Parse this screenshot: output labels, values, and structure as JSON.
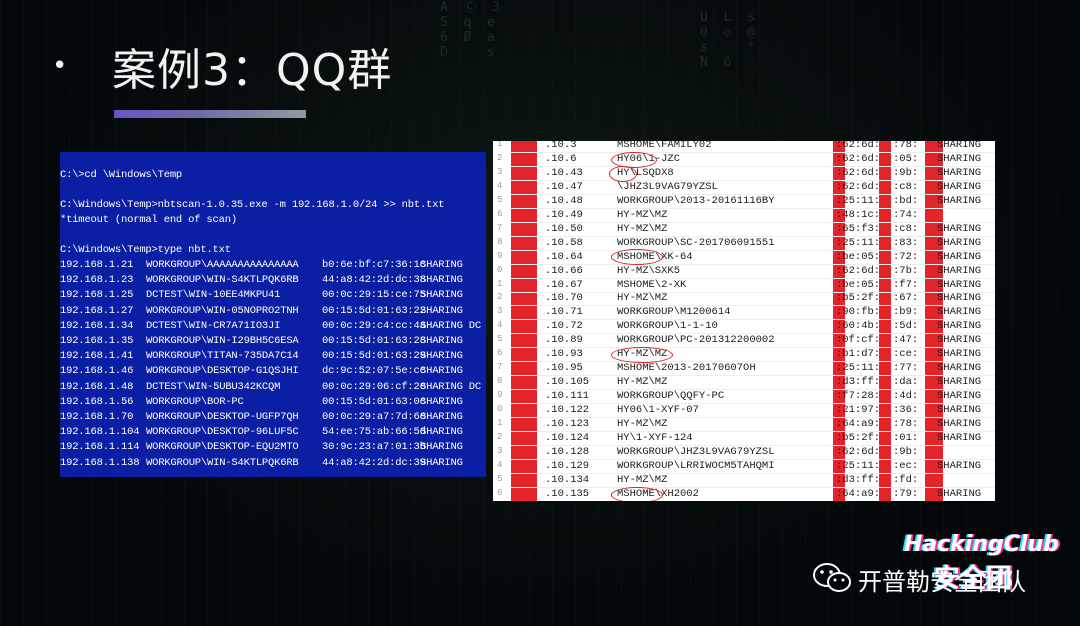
{
  "slide": {
    "bullet": "•",
    "title": "案例3：QQ群"
  },
  "terminal": {
    "lines": [
      "C:\\>cd \\Windows\\Temp",
      "C:\\Windows\\Temp>nbtscan-1.0.35.exe -m 192.168.1.0/24 >> nbt.txt",
      "*timeout (normal end of scan)",
      "C:\\Windows\\Temp>type nbt.txt"
    ],
    "rows": [
      {
        "ip": "192.168.1.21",
        "name": "WORKGROUP\\AAAAAAAAAAAAAAA",
        "mac": "b0:6e:bf:c7:36:1c",
        "status": "SHARING"
      },
      {
        "ip": "192.168.1.23",
        "name": "WORKGROUP\\WIN-S4KTLPQK6RB",
        "mac": "44:a8:42:2d:dc:38",
        "status": "SHARING"
      },
      {
        "ip": "192.168.1.25",
        "name": "DCTEST\\WIN-10EE4MKPU41",
        "mac": "00:0c:29:15:ce:75",
        "status": "SHARING"
      },
      {
        "ip": "192.168.1.27",
        "name": "WORKGROUP\\WIN-05NOPRO2TNH",
        "mac": "00:15:5d:01:63:22",
        "status": "SHARING"
      },
      {
        "ip": "192.168.1.34",
        "name": "DCTEST\\WIN-CR7A71IO3JI",
        "mac": "00:0c:29:c4:cc:4a",
        "status": "SHARING DC"
      },
      {
        "ip": "192.168.1.35",
        "name": "WORKGROUP\\WIN-I29BH5C6ESA",
        "mac": "00:15:5d:01:63:28",
        "status": "SHARING"
      },
      {
        "ip": "192.168.1.41",
        "name": "WORKGROUP\\TITAN-735DA7C14",
        "mac": "00:15:5d:01:63:29",
        "status": "SHARING"
      },
      {
        "ip": "192.168.1.46",
        "name": "WORKGROUP\\DESKTOP-G1QSJHI",
        "mac": "dc:9c:52:07:5e:cc",
        "status": "SHARING"
      },
      {
        "ip": "192.168.1.48",
        "name": "DCTEST\\WIN-5UBU342KCQM",
        "mac": "00:0c:29:06:cf:2e",
        "status": "SHARING DC"
      },
      {
        "ip": "192.168.1.56",
        "name": "WORKGROUP\\BOR-PC",
        "mac": "00:15:5d:01:63:0c",
        "status": "SHARING"
      },
      {
        "ip": "192.168.1.70",
        "name": "WORKGROUP\\DESKTOP-UGFP7QH",
        "mac": "00:0c:29:a7:7d:6e",
        "status": "SHARING"
      },
      {
        "ip": "192.168.1.104",
        "name": "WORKGROUP\\DESKTOP-96LUF5C",
        "mac": "54:ee:75:ab:66:5d",
        "status": "SHARING"
      },
      {
        "ip": "192.168.1.114",
        "name": "WORKGROUP\\DESKTOP-EQU2MTO",
        "mac": "30:9c:23:a7:01:3b",
        "status": "SHARING"
      },
      {
        "ip": "192.168.1.138",
        "name": "WORKGROUP\\WIN-S4KTLPQK6RB",
        "mac": "44:a8:42:2d:dc:39",
        "status": "SHARING"
      }
    ]
  },
  "sheet": {
    "rows": [
      {
        "n": "1",
        "ip": ".10.3",
        "name": "MSHOME\\FAMILY02",
        "mac": ":62:6d:",
        "m2": ":78:",
        "status": "SHARING"
      },
      {
        "n": "2",
        "ip": ".10.6",
        "name": "HY06\\1-JZC",
        "mac": ":62:6d:",
        "m2": ":05:",
        "status": "SHARING"
      },
      {
        "n": "3",
        "ip": ".10.43",
        "name": "HY\\LSQDX8",
        "mac": ":62:6d:",
        "m2": ":9b:",
        "status": "SHARING"
      },
      {
        "n": "4",
        "ip": ".10.47",
        "name": "\\JHZ3L9VAG79YZSL",
        "mac": ":62:6d:",
        "m2": ":c8:",
        "status": "SHARING"
      },
      {
        "n": "5",
        "ip": ".10.48",
        "name": "WORKGROUP\\2013-20161116BY",
        "mac": ":25:11:",
        "m2": ":bd:",
        "status": "SHARING"
      },
      {
        "n": "6",
        "ip": ".10.49",
        "name": "HY-MZ\\MZ",
        "mac": ":48:1c:",
        "m2": ":74:",
        "status": ""
      },
      {
        "n": "7",
        "ip": ".10.50",
        "name": "HY-MZ\\MZ",
        "mac": ":65:f3:",
        "m2": ":c8:",
        "status": "SHARING"
      },
      {
        "n": "8",
        "ip": ".10.58",
        "name": "WORKGROUP\\SC-201706091551",
        "mac": ":25:11:",
        "m2": ":83:",
        "status": "SHARING"
      },
      {
        "n": "9",
        "ip": ".10.64",
        "name": "MSHOME\\XK-64",
        "mac": ":be:05:",
        "m2": ":72:",
        "status": "SHARING"
      },
      {
        "n": "0",
        "ip": ".10.66",
        "name": "HY-MZ\\SXK5",
        "mac": ":62:6d:",
        "m2": ":7b:",
        "status": "SHARING"
      },
      {
        "n": "1",
        "ip": ".10.67",
        "name": "MSHOME\\2-XK",
        "mac": ":be:05:",
        "m2": ":f7:",
        "status": "SHARING"
      },
      {
        "n": "2",
        "ip": ".10.70",
        "name": "HY-MZ\\MZ",
        "mac": ":b5:2f:",
        "m2": ":67:",
        "status": "SHARING"
      },
      {
        "n": "3",
        "ip": ".10.71",
        "name": "WORKGROUP\\M1200614",
        "mac": ":90:fb:",
        "m2": ":b9:",
        "status": "SHARING"
      },
      {
        "n": "4",
        "ip": ".10.72",
        "name": "WORKGROUP\\1-1-10",
        "mac": ":60:4b:",
        "m2": ":5d:",
        "status": "SHARING"
      },
      {
        "n": "5",
        "ip": ".10.89",
        "name": "WORKGROUP\\PC-201312200002",
        "mac": ":0f:cf:",
        "m2": ":47:",
        "status": "SHARING"
      },
      {
        "n": "6",
        "ip": ".10.93",
        "name": "HY-MZ\\MZ",
        "mac": ":b1:d7:",
        "m2": ":ce:",
        "status": "SHARING"
      },
      {
        "n": "7",
        "ip": ".10.95",
        "name": "MSHOME\\2013-20170607OH",
        "mac": ":25:11:",
        "m2": ":77:",
        "status": "SHARING"
      },
      {
        "n": "8",
        "ip": ".10.105",
        "name": "HY-MZ\\MZ",
        "mac": ":d3:ff:",
        "m2": ":da:",
        "status": "SHARING"
      },
      {
        "n": "9",
        "ip": ".10.111",
        "name": "WORKGROUP\\QQFY-PC",
        "mac": ":f7:28:",
        "m2": ":4d:",
        "status": "SHARING"
      },
      {
        "n": "0",
        "ip": ".10.122",
        "name": "HY06\\1-XYF-07",
        "mac": ":21:97:",
        "m2": ":36:",
        "status": "SHARING"
      },
      {
        "n": "1",
        "ip": ".10.123",
        "name": "HY-MZ\\MZ",
        "mac": ":64:a9:",
        "m2": ":78:",
        "status": "SHARING"
      },
      {
        "n": "2",
        "ip": ".10.124",
        "name": "HY\\1-XYF-124",
        "mac": ":b5:2f:",
        "m2": ":01:",
        "status": "SHARING"
      },
      {
        "n": "3",
        "ip": ".10.128",
        "name": "WORKGROUP\\JHZ3L9VAG79YZSL",
        "mac": ":62:6d:",
        "m2": ":9b:",
        "status": ""
      },
      {
        "n": "4",
        "ip": ".10.129",
        "name": "WORKGROUP\\LRRIWOCM5TAHQMI",
        "mac": ":25:11:",
        "m2": ":ec:",
        "status": "SHARING"
      },
      {
        "n": "5",
        "ip": ".10.134",
        "name": "HY-MZ\\MZ",
        "mac": ":d3:ff:",
        "m2": ":fd:",
        "status": ""
      },
      {
        "n": "6",
        "ip": ".10.135",
        "name": "MSHOME\\XH2002",
        "mac": ":64:a9:",
        "m2": ":79:",
        "status": "SHARING"
      }
    ]
  },
  "logos": {
    "hackingclub": "HackingClub",
    "hackingclub_sub": "安全团",
    "wechat_text": "开普勒安全团队"
  },
  "colors": {
    "terminal_bg": "#0b1fa4",
    "red_bar": "#e3242b",
    "underline_start": "#6a55c7"
  }
}
